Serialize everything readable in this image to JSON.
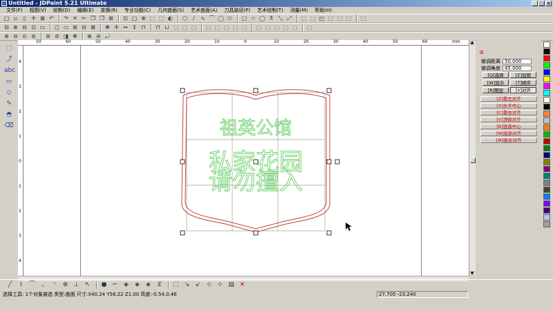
{
  "window": {
    "title": "Untitled - JDPaint 5.21 Ultimate",
    "min": "_",
    "max": "□",
    "close": "×"
  },
  "menu": [
    "文件(F)",
    "视图(V)",
    "绘制(D)",
    "编辑(E)",
    "变换(R)",
    "专业功能(C)",
    "几何曲面(S)",
    "艺术曲面(A)",
    "刀具路径(P)",
    "艺术绘制(T)",
    "测量(M)",
    "帮助(H)"
  ],
  "toolbar1": [
    "□",
    "▫",
    "▯",
    "✛",
    "⊠",
    "↶",
    "↷",
    "✕",
    "✂",
    "❐",
    "❐",
    "⊞",
    "⊡",
    "□",
    "⊕",
    "⬚",
    "⬚",
    "◐",
    "⬡",
    "/",
    "∿",
    "⌒",
    "◯",
    "⬭",
    "▢",
    "☆",
    "◯",
    "⊼",
    "⤡",
    "⤢",
    "⬚",
    "⬚",
    "◰",
    "⬚",
    "⬚",
    "⬚",
    "⬚"
  ],
  "toolbar2": [
    "⊟",
    "⊕",
    "⊟",
    "⊡",
    "▭",
    "◻",
    "▭",
    "⊞",
    "⊟",
    "⊠",
    "✥",
    "✛",
    "↔",
    "↕",
    "⊓",
    "⊓",
    "⊔",
    "⬚",
    "⬚",
    "⬚",
    "⬚",
    "⬚",
    "⬚",
    "⬚",
    "⬚",
    "⬚",
    "⬚",
    "⬚",
    "⬚",
    "⬚",
    "⬚"
  ],
  "toolbar3": [
    "⊕",
    "⊖",
    "⊙",
    "⊚",
    "⊛",
    "⊜",
    "◨",
    "✥",
    "⊕",
    "⊖",
    "⤾"
  ],
  "ruler": {
    "top_labels": [
      "50",
      "60",
      "50",
      "40",
      "30",
      "20",
      "10",
      "0",
      "10",
      "20",
      "30",
      "40",
      "50",
      "60",
      "mm"
    ],
    "left_labels": [
      "4",
      "3",
      "2",
      "1",
      "0",
      "1",
      "2",
      "3",
      "4"
    ]
  },
  "design": {
    "line1": "祖英公馆",
    "line2": "私家花园",
    "line3": "请勿擅入",
    "text_color": "#70d070",
    "outline_color": "#c04040",
    "grid_color": "#a0a080",
    "handle_color": "#000000"
  },
  "panel": {
    "tab_icon": "tab-icon",
    "dist_label": "微调距离",
    "dist_value": "50.000",
    "angle_label": "微调角度",
    "angle_value": "45.000",
    "btn_select": "[Q]选择",
    "btn_add": "[E]加锁",
    "btn_show": "[W]显示",
    "btn_order": "[T]顺序",
    "btn_layer": "[R]图层",
    "btn_align": "[Y]对齐",
    "align_items": [
      "[Z]靠左对齐",
      "[X]水平中心",
      "[C]靠右对齐",
      "[V]顶部对齐",
      "[B]竖直中心",
      "[N]底部对齐",
      "[M]组合对齐"
    ]
  },
  "palette": [
    "#ffffff",
    "#000000",
    "#ff0000",
    "#00ff00",
    "#0000ff",
    "#ffff00",
    "#ff00ff",
    "#00ffff",
    "#ffffff",
    "#000000",
    "#ff8040",
    "#c0c0c0",
    "#ff8000",
    "#00c000",
    "#c00000",
    "#008000",
    "#000080",
    "#808000",
    "#800080",
    "#008080",
    "#808080",
    "#404040",
    "#0080ff",
    "#8000ff",
    "#400080",
    "#c0c0ff",
    "#a0a0a0"
  ],
  "bottom_tools": [
    "╱",
    "⌇",
    "⌒",
    "◟",
    "◝",
    "⊕",
    "⊥",
    "↖",
    "●",
    "⌐",
    "◈",
    "◈",
    "◈",
    "⊻",
    "⬚",
    "↘",
    "↙",
    "⊹",
    "⊹",
    "▤",
    "✕"
  ],
  "status": {
    "text": "选择工具: 1个对象被选 类型:曲面 尺寸:X40.24 Y56.22 Z1.00 高度:-0.54,0.46",
    "coord": "27.705 -23.240"
  }
}
